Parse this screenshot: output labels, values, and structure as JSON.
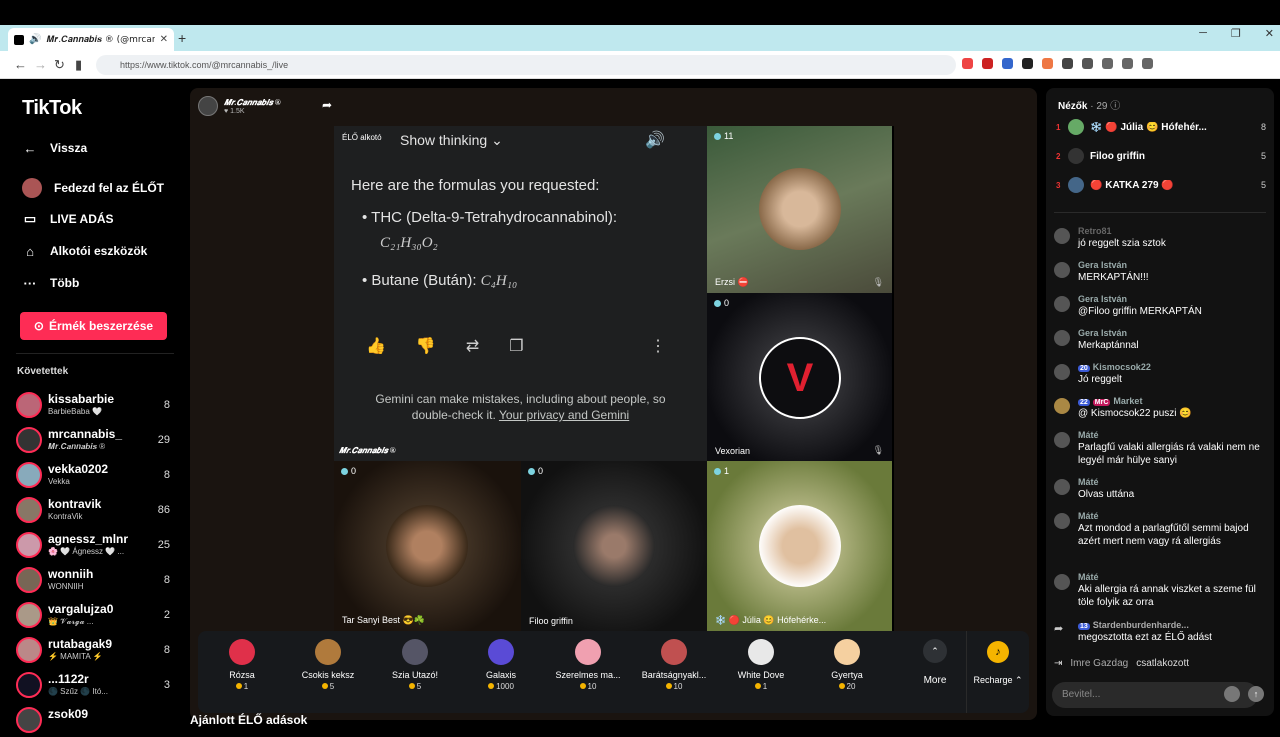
{
  "browser": {
    "tab_title": "𝑴𝒓.𝑪𝒂𝒏𝒏𝒂𝒃𝒊𝒔 ® (@mrcannabis_",
    "url": "https://www.tiktok.com/@mrcannabis_/live"
  },
  "sidebar": {
    "logo": "TikTok",
    "back": "Vissza",
    "items": [
      {
        "label": "Fedezd fel az ÉLŐT"
      },
      {
        "label": "LIVE ADÁS"
      },
      {
        "label": "Alkotói eszközök"
      },
      {
        "label": "Több"
      }
    ],
    "coins_button": "Érmék beszerzése",
    "following_title": "Követettek",
    "following": [
      {
        "name": "kissabarbie",
        "sub": "BarbieBaba 🤍",
        "count": "8"
      },
      {
        "name": "mrcannabis_",
        "sub": "𝑴𝒓.𝑪𝒂𝒏𝒏𝒂𝒃𝒊𝒔 ®",
        "count": "29"
      },
      {
        "name": "vekka0202",
        "sub": "Vekka",
        "count": "8"
      },
      {
        "name": "kontravik",
        "sub": "KontraVik",
        "count": "86"
      },
      {
        "name": "agnessz_mlnr",
        "sub": "🌸 🤍 Ágnessz 🤍 ...",
        "count": "25"
      },
      {
        "name": "wonniih",
        "sub": "WONNIIH",
        "count": "8"
      },
      {
        "name": "vargalujza0",
        "sub": "👑 𝓥𝓪𝓻𝓰𝓪 ...",
        "count": "2"
      },
      {
        "name": "rutabagak9",
        "sub": "⚡ MAMITA ⚡",
        "count": "8"
      },
      {
        "name": "...1122r",
        "sub": "🌑 Szűz 🌑 Itó...",
        "count": "3"
      },
      {
        "name": "zsok09",
        "sub": "",
        "count": ""
      }
    ]
  },
  "host": {
    "name": "𝑴𝒓.𝑪𝒂𝒏𝒏𝒂𝒃𝒊𝒔 ®",
    "likes": "1.5K"
  },
  "gemini": {
    "badge": "ÉLŐ alkotó",
    "show_thinking": "Show thinking",
    "intro": "Here are the formulas you requested:",
    "item1_label": "THC (Delta-9-Tetrahydrocannabinol):",
    "item1_formula": "C₂₁H₃₀O₂",
    "item2_label": "Butane (Bután):",
    "item2_formula": "C₄H₁₀",
    "disclaimer1": "Gemini can make mistakes, including about people, so",
    "disclaimer2": "double-check it.",
    "disclaimer_link": "Your privacy and Gemini",
    "signature": "𝑴𝒓.𝑪𝒂𝒏𝒏𝒂𝒃𝒊𝒔 ®"
  },
  "guests": [
    {
      "name": "Erzsi ⛔",
      "count": "11"
    },
    {
      "name": "Vexorian",
      "count": "0"
    },
    {
      "name": "Tar Sanyi Best 😎☘️",
      "count": "0"
    },
    {
      "name": "Filoo griffin",
      "count": "0"
    },
    {
      "name": "❄️ 🔴 Júlia 😊 Hófehérke...",
      "count": "1"
    }
  ],
  "gifts": [
    {
      "name": "Rózsa",
      "price": "1",
      "color": "#e0304a"
    },
    {
      "name": "Csokis keksz",
      "price": "5",
      "color": "#b07a3c"
    },
    {
      "name": "Szia Utazó!",
      "price": "5",
      "color": "#556"
    },
    {
      "name": "Galaxis",
      "price": "1000",
      "color": "#5a4bd6"
    },
    {
      "name": "Szerelmes ma...",
      "price": "10",
      "color": "#f0a0b0"
    },
    {
      "name": "Barátságnyakl...",
      "price": "10",
      "color": "#c05050"
    },
    {
      "name": "White Dove",
      "price": "1",
      "color": "#e8e8e8"
    },
    {
      "name": "Gyertya",
      "price": "20",
      "color": "#f5d0a0"
    }
  ],
  "more_label": "More",
  "recharge_label": "Recharge",
  "below_title": "Ajánlott ÉLŐ adások",
  "chat": {
    "viewers_label": "Nézők",
    "viewers_count": "· 29",
    "top_viewers": [
      {
        "rank": "1",
        "name": "❄️ 🔴 Júlia 😊 Hófehér...",
        "count": "8"
      },
      {
        "rank": "2",
        "name": "Filoo griffin",
        "count": "5"
      },
      {
        "rank": "3",
        "name": "🔴 KATKA 279 🔴",
        "count": "5"
      }
    ],
    "messages": [
      {
        "user": "Retro81",
        "text": "jó reggelt szia sztok"
      },
      {
        "user": "Gera István",
        "text": "MERKAPTÁN!!!"
      },
      {
        "user": "Gera István",
        "text": "@Filoo griffin MERKAPTÁN"
      },
      {
        "user": "Gera István",
        "text": "Merkaptánnal"
      },
      {
        "user": "Kismocsok22",
        "level": "20",
        "text": "Jó reggelt"
      },
      {
        "user": "Market",
        "level": "22",
        "badge": "MrC",
        "text": "@ Kismocsok22 puszi 😊"
      },
      {
        "user": "Máté",
        "text": "Parlagfű valaki allergiás rá valaki nem ne legyél már hülye sanyi"
      },
      {
        "user": "Máté",
        "text": "Olvas uttána"
      },
      {
        "user": "Máté",
        "text": "Azt mondod a parlagfűtől semmi bajod azért mert nem vagy rá allergiás"
      },
      {
        "user": "Máté",
        "text": "Aki allergia rá annak viszket a szeme fül töle folyik az orra"
      }
    ],
    "share_user": "Stardenburdenharde...",
    "share_level": "13",
    "share_text": "megosztotta ezt az ÉLŐ adást",
    "join_user": "Imre Gazdag",
    "join_text": "csatlakozott",
    "input_placeholder": "Bevitel..."
  }
}
